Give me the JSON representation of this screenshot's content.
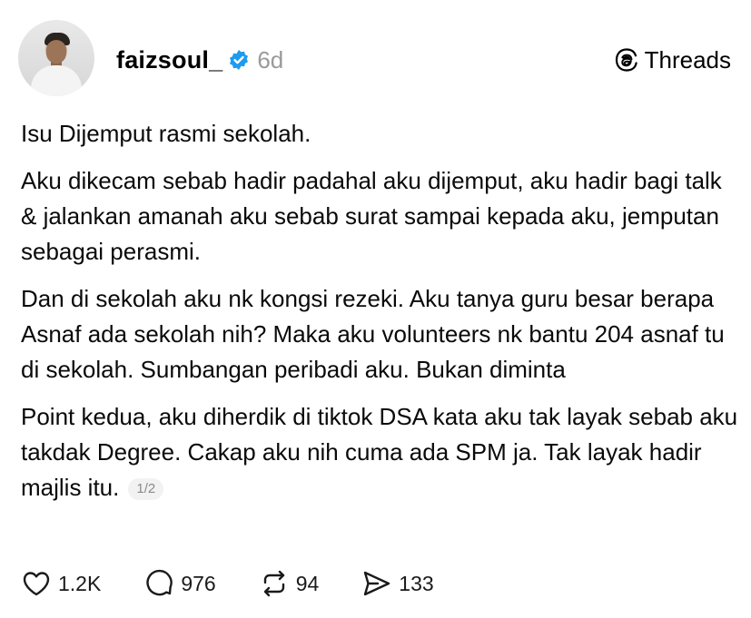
{
  "author": {
    "username": "faizsoul_",
    "time": "6d",
    "avatar_icon": "profile-photo"
  },
  "brand": {
    "label": "Threads"
  },
  "post": {
    "paragraphs": [
      "Isu Dijemput rasmi sekolah.",
      "Aku dikecam sebab hadir padahal aku dijemput, aku hadir bagi talk & jalankan amanah aku sebab surat sampai kepada aku, jemputan sebagai perasmi.",
      "Dan di sekolah aku nk kongsi rezeki. Aku tanya guru besar berapa Asnaf ada sekolah nih? Maka aku volunteers nk bantu 204 asnaf tu di sekolah. Sumbangan peribadi aku. Bukan diminta",
      "Point kedua, aku diherdik di tiktok DSA kata aku tak layak sebab aku takdak Degree. Cakap aku nih cuma ada SPM ja. Tak layak hadir majlis itu."
    ],
    "pager": "1/2"
  },
  "stats": {
    "likes": "1.2K",
    "replies": "976",
    "reposts": "94",
    "shares": "133"
  },
  "colors": {
    "verified": "#1d9bf0",
    "muted": "#9a9a9a"
  }
}
